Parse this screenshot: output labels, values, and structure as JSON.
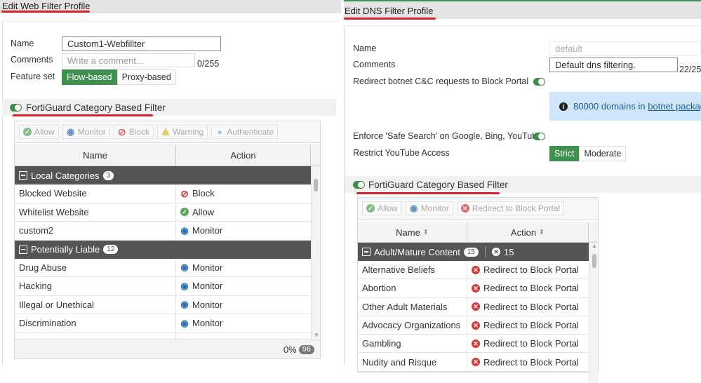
{
  "web_filter": {
    "title": "Edit Web Filter Profile",
    "name_label": "Name",
    "name_value": "Custom1-Webfillter",
    "comments_label": "Comments",
    "comments_placeholder": "Write a comment...",
    "comments_count": "0/255",
    "feature_label": "Feature set",
    "feature_options": [
      "Flow-based",
      "Proxy-based"
    ],
    "feature_selected": "Flow-based",
    "section_title": "FortiGuard Category Based Filter",
    "toolbar": [
      "Allow",
      "Monitor",
      "Block",
      "Warning",
      "Authenticate"
    ],
    "columns": [
      "Name",
      "Action"
    ],
    "groups": [
      {
        "name": "Local Categories",
        "count": "3",
        "rows": [
          [
            "Blocked Website",
            "Block"
          ],
          [
            "Whitelist Website",
            "Allow"
          ],
          [
            "custom2",
            "Monitor"
          ]
        ]
      },
      {
        "name": "Potentially Liable",
        "count": "12",
        "rows": [
          [
            "Drug Abuse",
            "Monitor"
          ],
          [
            "Hacking",
            "Monitor"
          ],
          [
            "Illegal or Unethical",
            "Monitor"
          ],
          [
            "Discrimination",
            "Monitor"
          ]
        ]
      }
    ],
    "footer_percent": "0%",
    "footer_count": "96"
  },
  "dns_filter": {
    "title": "Edit DNS Filter Profile",
    "name_label": "Name",
    "name_value": "default",
    "comments_label": "Comments",
    "comments_value": "Default dns filtering.",
    "comments_count": "22/25",
    "botnet_label": "Redirect botnet C&C requests to Block Portal",
    "botnet_enabled": true,
    "info_count": "80000 domains in ",
    "info_link": "botnet package",
    "safe_search_label": "Enforce 'Safe Search' on Google, Bing, YouTube",
    "safe_search_enabled": true,
    "youtube_label": "Restrict YouTube Access",
    "youtube_options": [
      "Strict",
      "Moderate"
    ],
    "youtube_selected": "Strict",
    "section_title": "FortiGuard Category Based Filter",
    "toolbar": [
      "Allow",
      "Monitor",
      "Redirect to Block Portal"
    ],
    "columns": [
      "Name",
      "Action"
    ],
    "group": {
      "name": "Adult/Mature Content",
      "count": "15",
      "action_count": "15"
    },
    "rows": [
      [
        "Alternative Beliefs",
        "Redirect to Block Portal"
      ],
      [
        "Abortion",
        "Redirect to Block Portal"
      ],
      [
        "Other Adult Materials",
        "Redirect to Block Portal"
      ],
      [
        "Advocacy Organizations",
        "Redirect to Block Portal"
      ],
      [
        "Gambling",
        "Redirect to Block Portal"
      ],
      [
        "Nudity and Risque",
        "Redirect to Block Portal"
      ]
    ]
  },
  "colors": {
    "accent_green": "#3f8f4f",
    "highlight_red": "#d6232b",
    "group_row": "#555555",
    "info_bg": "#cfe5fa"
  }
}
